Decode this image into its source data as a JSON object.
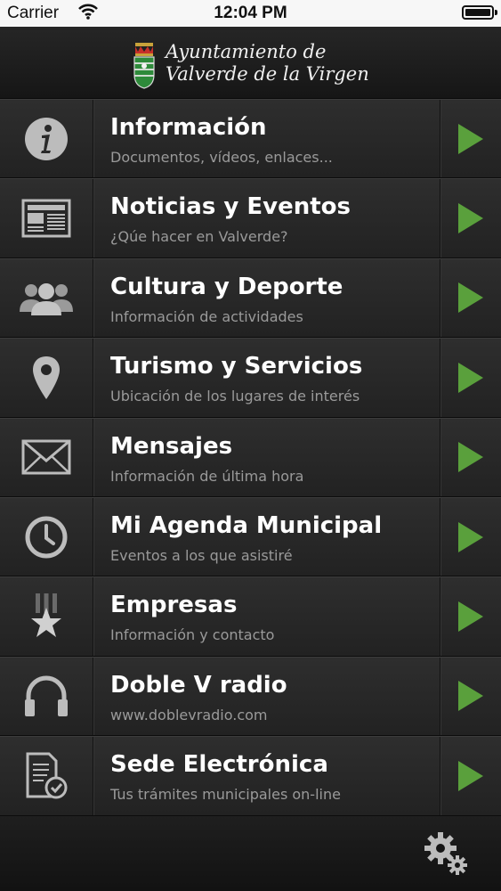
{
  "status_bar": {
    "carrier": "Carrier",
    "time": "12:04 PM"
  },
  "header": {
    "title_line1": "Ayuntamiento de",
    "title_line2": "Valverde de la Virgen"
  },
  "menu": [
    {
      "title": "Información",
      "subtitle": "Documentos, vídeos, enlaces...",
      "icon": "info-icon"
    },
    {
      "title": "Noticias y Eventos",
      "subtitle": "¿Qúe hacer en Valverde?",
      "icon": "newspaper-icon"
    },
    {
      "title": "Cultura y Deporte",
      "subtitle": "Información de actividades",
      "icon": "people-icon"
    },
    {
      "title": "Turismo y Servicios",
      "subtitle": "Ubicación de los lugares de interés",
      "icon": "location-pin-icon"
    },
    {
      "title": "Mensajes",
      "subtitle": "Información de última hora",
      "icon": "envelope-icon"
    },
    {
      "title": "Mi Agenda Municipal",
      "subtitle": "Eventos a los que asistiré",
      "icon": "clock-icon"
    },
    {
      "title": "Empresas",
      "subtitle": "Información y contacto",
      "icon": "star-badge-icon"
    },
    {
      "title": "Doble V radio",
      "subtitle": "www.doblevradio.com",
      "icon": "headphones-icon"
    },
    {
      "title": "Sede Electrónica",
      "subtitle": "Tus trámites municipales on-line",
      "icon": "document-check-icon"
    }
  ],
  "colors": {
    "arrow": "#5aa03c",
    "background": "#1c1c1c",
    "subtitle": "#9a9a9a"
  }
}
